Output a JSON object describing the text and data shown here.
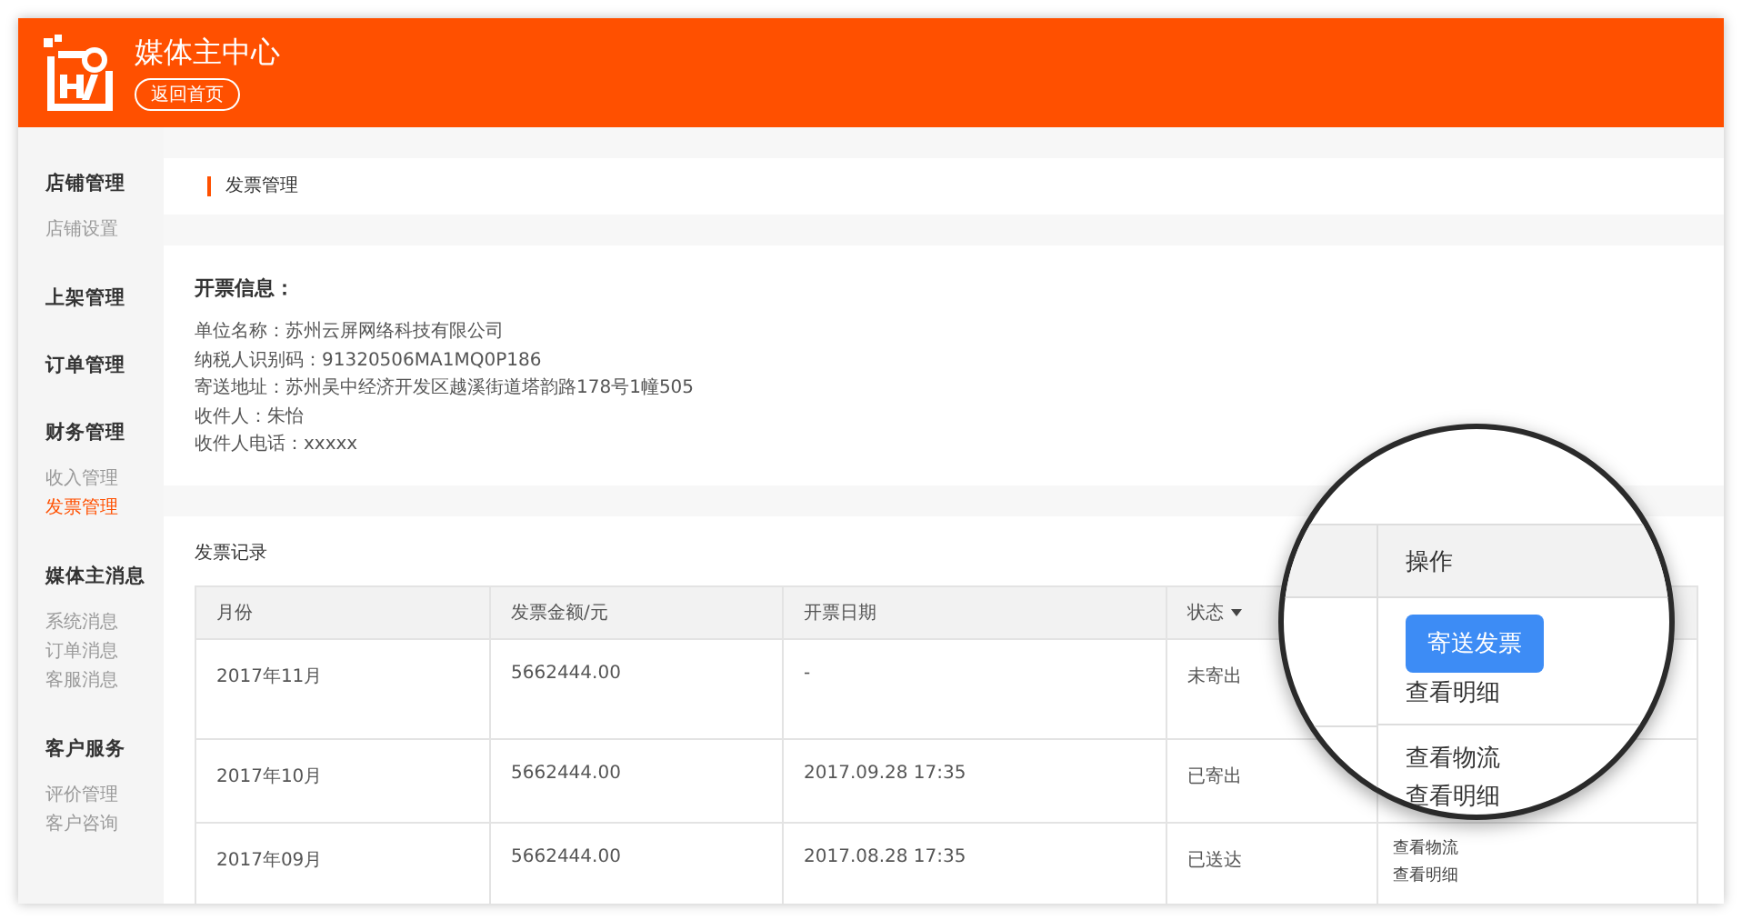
{
  "header": {
    "title": "媒体主中心",
    "back_button": "返回首页"
  },
  "sidebar": {
    "groups": [
      {
        "title": "店铺管理",
        "items": [
          {
            "label": "店铺设置",
            "selected": false
          }
        ]
      },
      {
        "title": "上架管理"
      },
      {
        "title": "订单管理"
      },
      {
        "title": "财务管理",
        "items": [
          {
            "label": "收入管理",
            "selected": false
          },
          {
            "label": "发票管理",
            "selected": true
          }
        ]
      },
      {
        "title": "媒体主消息",
        "items": [
          {
            "label": "系统消息",
            "selected": false
          },
          {
            "label": "订单消息",
            "selected": false
          },
          {
            "label": "客服消息",
            "selected": false
          }
        ]
      },
      {
        "title": "客户服务",
        "items": [
          {
            "label": "评价管理",
            "selected": false
          },
          {
            "label": "客户咨询",
            "selected": false
          }
        ]
      }
    ]
  },
  "breadcrumb": "发票管理",
  "invoice_info": {
    "title": "开票信息：",
    "lines": [
      "单位名称：苏州云屏网络科技有限公司",
      "纳税人识别码：91320506MA1MQ0P186",
      "寄送地址：苏州吴中经济开发区越溪街道塔韵路178号1幢505",
      "收件人：朱怡",
      "收件人电话：xxxxx"
    ]
  },
  "records": {
    "title": "发票记录",
    "columns": [
      {
        "label": "月份",
        "sortable": false
      },
      {
        "label": "发票金额/元",
        "sortable": false
      },
      {
        "label": "开票日期",
        "sortable": false
      },
      {
        "label": "状态",
        "sortable": true
      }
    ],
    "rows": [
      {
        "month": "2017年11月",
        "amount": "5662444.00",
        "date": "-",
        "status": "未寄出"
      },
      {
        "month": "2017年10月",
        "amount": "5662444.00",
        "date": "2017.09.28 17:35",
        "status": "已寄出"
      },
      {
        "month": "2017年09月",
        "amount": "5662444.00",
        "date": "2017.08.28 17:35",
        "status": "已送达",
        "actions": [
          "查看物流",
          "查看明细"
        ]
      }
    ]
  },
  "magnifier": {
    "header": "操作",
    "rows": [
      {
        "button": "寄送发票",
        "links": [
          "查看明细"
        ]
      },
      {
        "links": [
          "查看物流",
          "查看明细"
        ]
      }
    ]
  }
}
